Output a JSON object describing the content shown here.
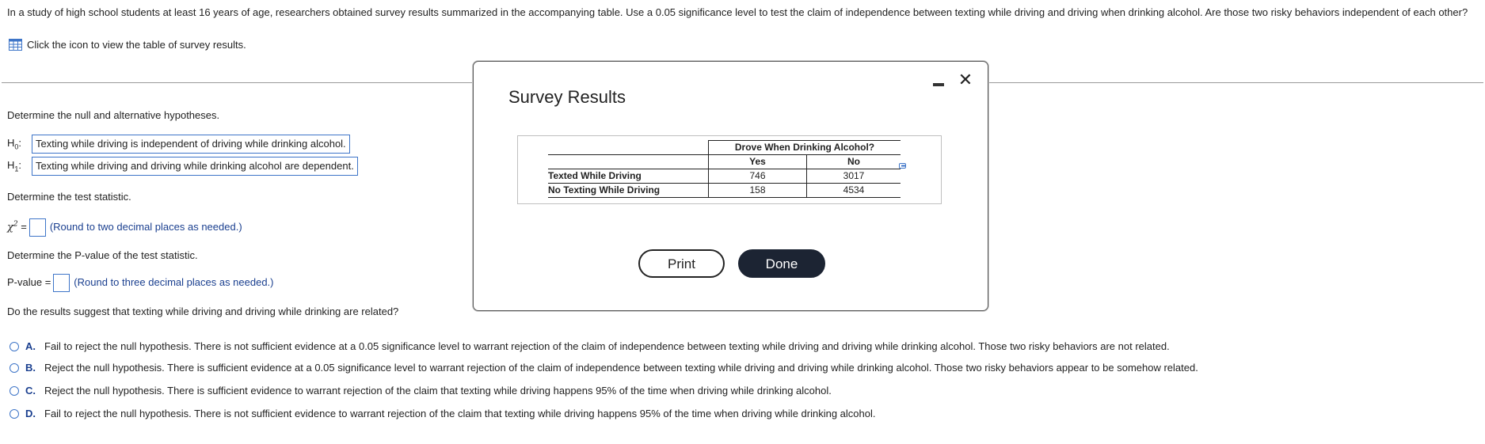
{
  "question": {
    "intro": "In a study of high school students at least 16 years of age, researchers obtained survey results summarized in the accompanying table. Use a 0.05 significance level to test the claim of independence between texting while driving and driving when drinking alcohol. Are those two risky behaviors independent of each other?",
    "icon_link": "Click the icon to view the table of survey results."
  },
  "parts": {
    "hypotheses_prompt": "Determine the null and alternative hypotheses.",
    "h0_label": "H",
    "h0_sub": "0",
    "h0_value": "Texting while driving is independent of driving while drinking alcohol.",
    "h1_label": "H",
    "h1_sub": "1",
    "h1_value": "Texting while driving and driving while drinking alcohol are dependent.",
    "statistic_prompt": "Determine the test statistic.",
    "chi_label": "χ",
    "chi_sup": "2",
    "equals": "=",
    "chi_hint": "(Round to two decimal places as needed.)",
    "pvalue_prompt": "Determine the P-value of the test statistic.",
    "pvalue_label": "P-value =",
    "pvalue_hint": "(Round to three decimal places as needed.)",
    "related_prompt": "Do the results suggest that texting while driving and driving while drinking are related?"
  },
  "options": [
    {
      "letter": "A.",
      "text": "Fail to reject the null hypothesis. There is not sufficient evidence at a 0.05 significance level to warrant rejection of the claim of independence between texting while driving and driving while drinking alcohol. Those two risky behaviors are not related."
    },
    {
      "letter": "B.",
      "text": "Reject the null hypothesis. There is sufficient evidence at a 0.05 significance level to warrant rejection of the claim of independence between texting while driving and driving while drinking alcohol. Those two risky behaviors appear to be somehow related."
    },
    {
      "letter": "C.",
      "text": "Reject the null hypothesis. There is sufficient evidence to warrant rejection of the claim that texting while driving happens 95% of the time when driving while drinking alcohol."
    },
    {
      "letter": "D.",
      "text": "Fail to reject the null hypothesis. There is not sufficient evidence to warrant rejection of the claim that texting while driving happens 95% of the time when driving while drinking alcohol."
    }
  ],
  "modal": {
    "title": "Survey Results",
    "table": {
      "group_header": "Drove When Drinking Alcohol?",
      "col_yes": "Yes",
      "col_no": "No",
      "rows": [
        {
          "label": "Texted While Driving",
          "yes": "746",
          "no": "3017"
        },
        {
          "label": "No Texting While Driving",
          "yes": "158",
          "no": "4534"
        }
      ]
    },
    "print_label": "Print",
    "done_label": "Done"
  },
  "icons": {
    "table": "table-grid-icon",
    "minimize": "minimize-icon",
    "close": "close-icon",
    "copy": "copy-to-clipboard-icon"
  },
  "colors": {
    "accent_blue": "#3e75c8",
    "hint_blue": "#1a3f8f",
    "done_button": "#1c2433"
  }
}
